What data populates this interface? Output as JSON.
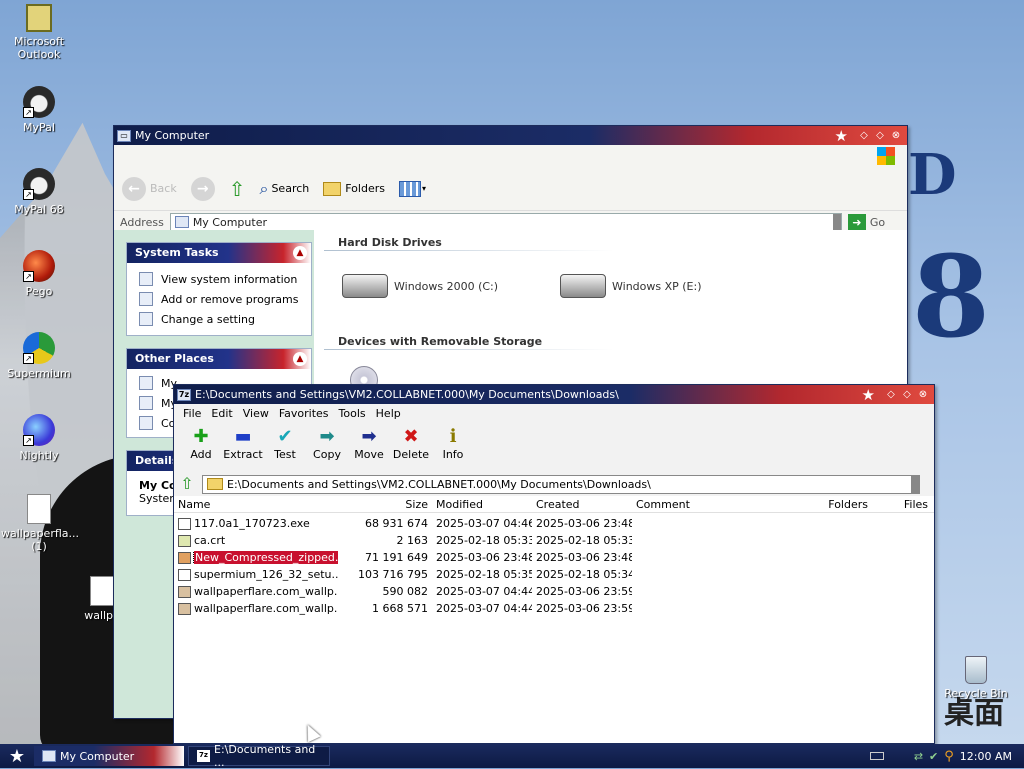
{
  "desktop": {
    "icons": [
      {
        "label": "Microsoft Outlook"
      },
      {
        "label": "MyPal"
      },
      {
        "label": "MyPal 68"
      },
      {
        "label": "Pego"
      },
      {
        "label": "Supermium"
      },
      {
        "label": "Nightly"
      },
      {
        "label": "wallpaperfla... (1)"
      },
      {
        "label": "wallpa"
      },
      {
        "label": "Recycle Bin"
      }
    ],
    "wallpaper_text": {
      "d": "D",
      "eight": "8",
      "cn": "桌面"
    }
  },
  "my_computer": {
    "title": "My Computer",
    "toolbar": {
      "back": "Back",
      "search": "Search",
      "folders": "Folders"
    },
    "address_label": "Address",
    "address_value": "My Computer",
    "go_label": "Go",
    "system_tasks": {
      "title": "System Tasks",
      "items": [
        "View system information",
        "Add or remove programs",
        "Change a setting"
      ]
    },
    "other_places": {
      "title": "Other Places",
      "items": [
        "My",
        "My",
        "Co"
      ]
    },
    "details": {
      "title": "Details",
      "line1": "My Co",
      "line2": "System"
    },
    "hard_disks_title": "Hard Disk Drives",
    "drives": [
      "Windows 2000 (C:)",
      "Windows XP (E:)"
    ],
    "removable_title": "Devices with Removable Storage"
  },
  "zip": {
    "title": "E:\\Documents and Settings\\VM2.COLLABNET.000\\My Documents\\Downloads\\",
    "menu": [
      "File",
      "Edit",
      "View",
      "Favorites",
      "Tools",
      "Help"
    ],
    "toolbar": [
      {
        "label": "Add",
        "glyph": "✚",
        "color": "#19a019"
      },
      {
        "label": "Extract",
        "glyph": "▬",
        "color": "#1f3fc7"
      },
      {
        "label": "Test",
        "glyph": "✔",
        "color": "#18a8b8"
      },
      {
        "label": "Copy",
        "glyph": "➡",
        "color": "#1f8a8a"
      },
      {
        "label": "Move",
        "glyph": "➡",
        "color": "#1f2f8f"
      },
      {
        "label": "Delete",
        "glyph": "✖",
        "color": "#d01818"
      },
      {
        "label": "Info",
        "glyph": "ℹ",
        "color": "#8a7a00"
      }
    ],
    "path": "E:\\Documents and Settings\\VM2.COLLABNET.000\\My Documents\\Downloads\\",
    "columns": {
      "name": "Name",
      "size": "Size",
      "modified": "Modified",
      "created": "Created",
      "comment": "Comment",
      "folders": "Folders",
      "files": "Files"
    },
    "files": [
      {
        "name": "117.0a1_170723.exe",
        "size": "68 931 674",
        "modified": "2025-03-07 04:46",
        "created": "2025-03-06 23:48",
        "selected": false
      },
      {
        "name": "ca.crt",
        "size": "2 163",
        "modified": "2025-02-18 05:33",
        "created": "2025-02-18 05:33",
        "selected": false
      },
      {
        "name": "New_Compressed_zipped...",
        "size": "71 191 649",
        "modified": "2025-03-06 23:48",
        "created": "2025-03-06 23:48",
        "selected": true
      },
      {
        "name": "supermium_126_32_setu...",
        "size": "103 716 795",
        "modified": "2025-02-18 05:35",
        "created": "2025-02-18 05:34",
        "selected": false
      },
      {
        "name": "wallpaperflare.com_wallp...",
        "size": "590 082",
        "modified": "2025-03-07 04:44",
        "created": "2025-03-06 23:59",
        "selected": false
      },
      {
        "name": "wallpaperflare.com_wallp...",
        "size": "1 668 571",
        "modified": "2025-03-07 04:44",
        "created": "2025-03-06 23:59",
        "selected": false
      }
    ]
  },
  "taskbar": {
    "tasks": [
      "My Computer",
      "E:\\Documents and ..."
    ],
    "clock": "12:00 AM"
  },
  "colors": {
    "titlebar_navy": "#1b2c66",
    "titlebar_red": "#e04a3f",
    "selection": "#c8102e"
  }
}
